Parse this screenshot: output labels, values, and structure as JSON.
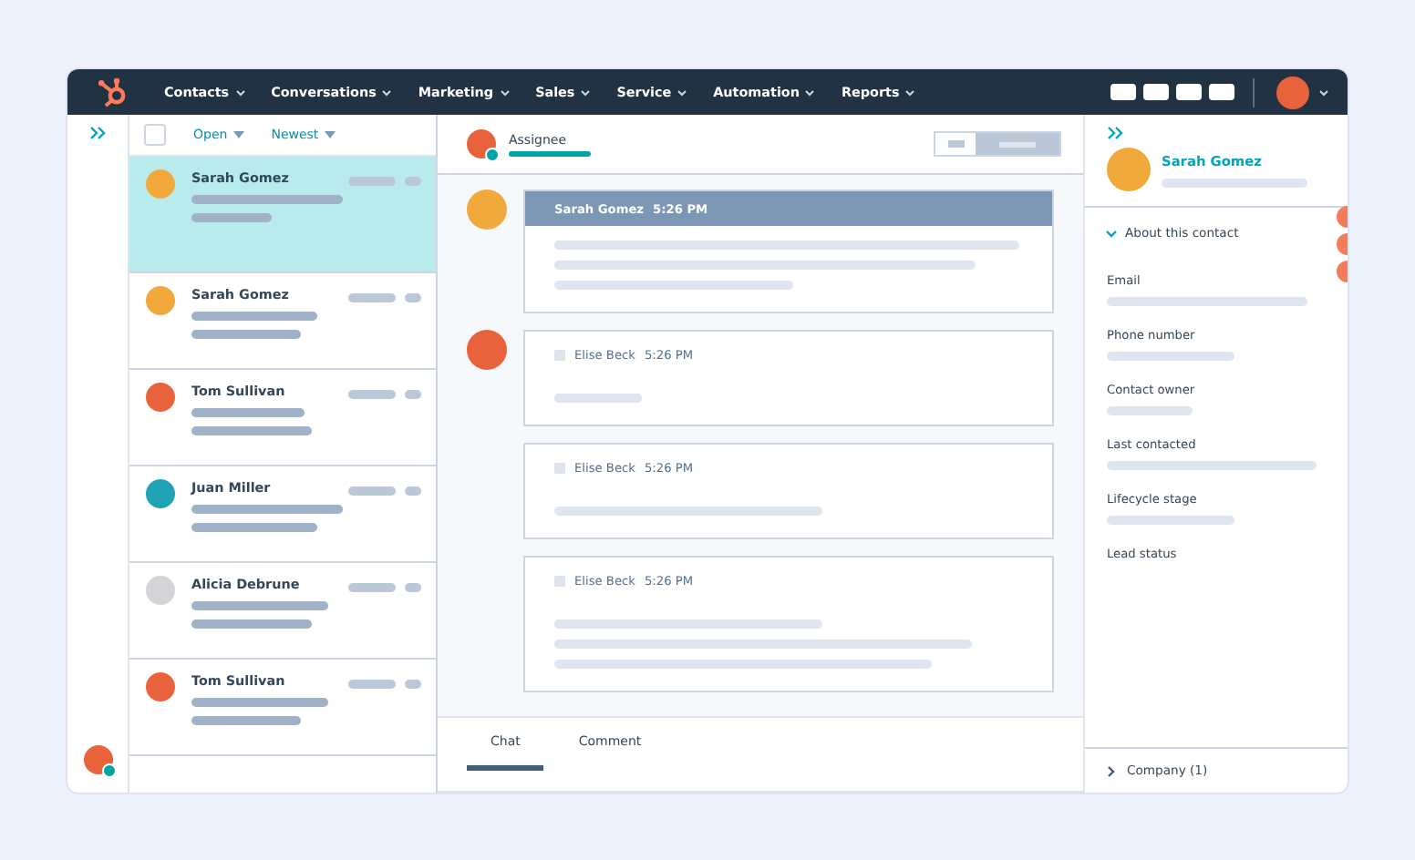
{
  "nav": {
    "items": [
      {
        "label": "Contacts"
      },
      {
        "label": "Conversations"
      },
      {
        "label": "Marketing"
      },
      {
        "label": "Sales"
      },
      {
        "label": "Service"
      },
      {
        "label": "Automation"
      },
      {
        "label": "Reports"
      }
    ]
  },
  "inbox": {
    "all_checked": false,
    "filters": [
      {
        "label": "Open"
      },
      {
        "label": "Newest"
      }
    ],
    "threads": [
      {
        "name": "Sarah Gomez",
        "color": "#f2a93b",
        "selected": true
      },
      {
        "name": "Sarah Gomez",
        "color": "#f2a93b",
        "selected": false
      },
      {
        "name": "Tom Sullivan",
        "color": "#e8623c",
        "selected": false
      },
      {
        "name": "Juan Miller",
        "color": "#1fa3b5",
        "selected": false
      },
      {
        "name": "Alicia Debrune",
        "color": "#d4d4d8",
        "selected": false
      },
      {
        "name": "Tom Sullivan",
        "color": "#e8623c",
        "selected": false
      }
    ]
  },
  "conversation": {
    "assignee": "Assignee",
    "messages": [
      {
        "kind": "highlighted",
        "author": "Sarah Gomez",
        "time": "5:26 PM",
        "avatar": true
      },
      {
        "kind": "plain",
        "author": "Elise Beck",
        "time": "5:26 PM",
        "avatar": true
      },
      {
        "kind": "plain",
        "author": "Elise Beck",
        "time": "5:26 PM",
        "avatar": false
      },
      {
        "kind": "plain",
        "author": "Elise Beck",
        "time": "5:26 PM",
        "avatar": false
      }
    ],
    "tabs": [
      {
        "label": "Chat",
        "selected": true
      },
      {
        "label": "Comment",
        "selected": false
      }
    ]
  },
  "contact": {
    "name": "Sarah Gomez",
    "section": "About this contact",
    "expanded": true,
    "fields": [
      {
        "label": "Email"
      },
      {
        "label": "Phone number"
      },
      {
        "label": "Contact owner"
      },
      {
        "label": "Last contacted"
      },
      {
        "label": "Lifecycle stage"
      },
      {
        "label": "Lead status"
      }
    ],
    "footer": "Company (1)"
  }
}
